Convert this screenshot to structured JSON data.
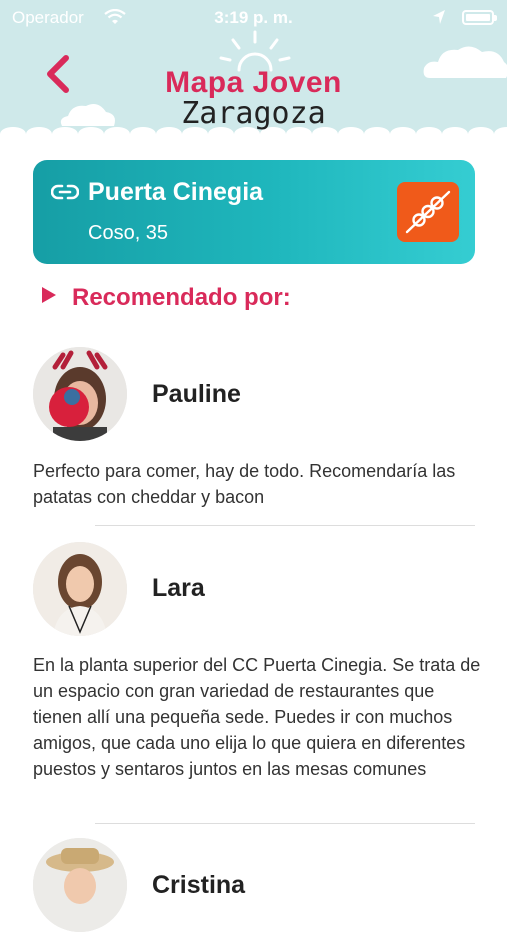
{
  "status_bar": {
    "carrier": "Operador",
    "time": "3:19 p. m."
  },
  "app": {
    "title_line1": "Mapa Joven",
    "title_line2": "Zaragoza"
  },
  "place": {
    "name": "Puerta Cinegia",
    "address": "Coso, 35",
    "category_icon": "skewer-icon",
    "accent": "#f05a1a"
  },
  "recommended_label": "Recomendado por:",
  "recommendations": [
    {
      "name": "Pauline",
      "text": "Perfecto para comer, hay de todo. Recomendaría las patatas con cheddar y bacon"
    },
    {
      "name": "Lara",
      "text": "En la planta superior del CC Puerta Cinegia. Se trata de un espacio con gran variedad de restaurantes que tienen allí una pequeña sede. Puedes ir con muchos amigos, que cada uno elija lo que quiera en diferentes puestos y sentaros juntos en las mesas comunes"
    },
    {
      "name": "Cristina",
      "text": ""
    }
  ],
  "colors": {
    "brand": "#d92a5a",
    "header_bg": "#cfe9ea",
    "card_start": "#169ea5",
    "card_end": "#35cdd2"
  }
}
